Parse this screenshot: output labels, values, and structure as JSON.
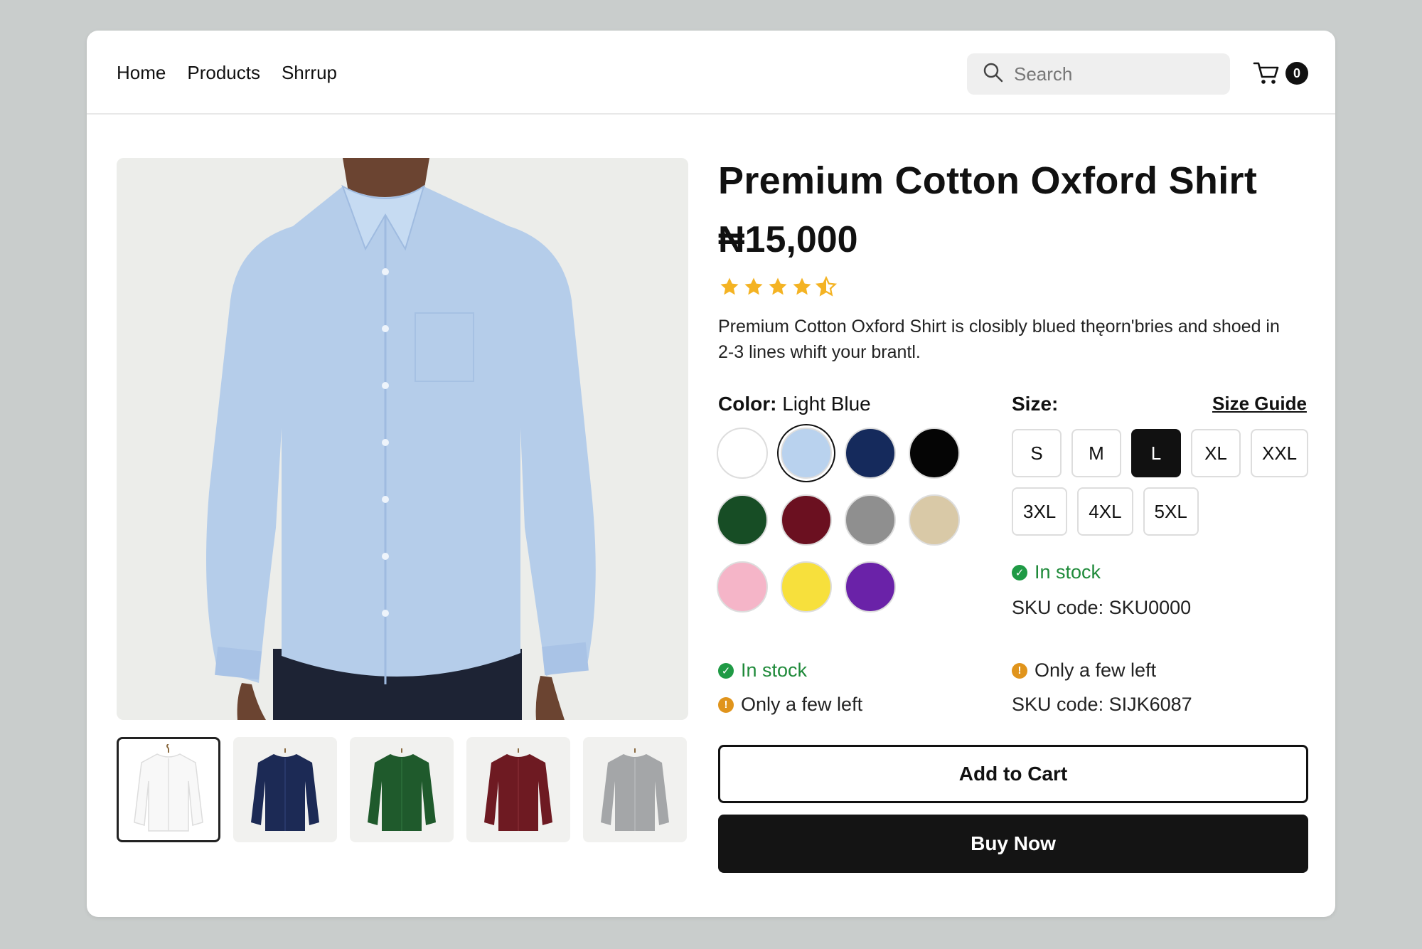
{
  "nav": {
    "links": [
      "Home",
      "Products",
      "Shrrup"
    ],
    "search_placeholder": "Search",
    "cart_count": "0"
  },
  "product": {
    "title": "Premium Cotton Oxford Shirt",
    "price": "₦15,000",
    "rating": 4.5,
    "description": "Premium Cotton Oxford Shirt is closibly blued thęorn'bries and shoed in 2-3 lines whift your brantl.",
    "color_label": "Color:",
    "color_value": "Light Blue",
    "colors": [
      {
        "name": "white",
        "hex": "#ffffff"
      },
      {
        "name": "light-blue",
        "hex": "#b9d2ee",
        "selected": true
      },
      {
        "name": "navy",
        "hex": "#152a5c"
      },
      {
        "name": "black",
        "hex": "#050505"
      },
      {
        "name": "dark-green",
        "hex": "#174d25"
      },
      {
        "name": "burgundy",
        "hex": "#6b1020"
      },
      {
        "name": "gray",
        "hex": "#8f8f8f"
      },
      {
        "name": "beige",
        "hex": "#d9c9a7"
      },
      {
        "name": "pink",
        "hex": "#f5b5c8"
      },
      {
        "name": "yellow",
        "hex": "#f7e03c"
      },
      {
        "name": "purple",
        "hex": "#6a22a8"
      }
    ],
    "size_label": "Size:",
    "size_guide": "Size Guide",
    "sizes": [
      "S",
      "M",
      "L",
      "XL",
      "XXL",
      "3XL",
      "4XL",
      "5XL"
    ],
    "selected_size": "L",
    "status_right": {
      "in_stock": "In stock",
      "sku": "SKU code: SKU0000",
      "few_left": "Only a few left",
      "sku2": "SKU code: SIJK6087"
    },
    "status_left": {
      "in_stock": "In stock",
      "few_left": "Only a few left"
    },
    "add_to_cart": "Add to Cart",
    "buy_now": "Buy Now",
    "thumbnails": [
      {
        "color": "#f7f7f7",
        "selected": true
      },
      {
        "color": "#1c2a55"
      },
      {
        "color": "#1f5a2c"
      },
      {
        "color": "#6e1a22"
      },
      {
        "color": "#a4a6a8"
      }
    ],
    "main_shirt_color": "#b5cdea"
  }
}
